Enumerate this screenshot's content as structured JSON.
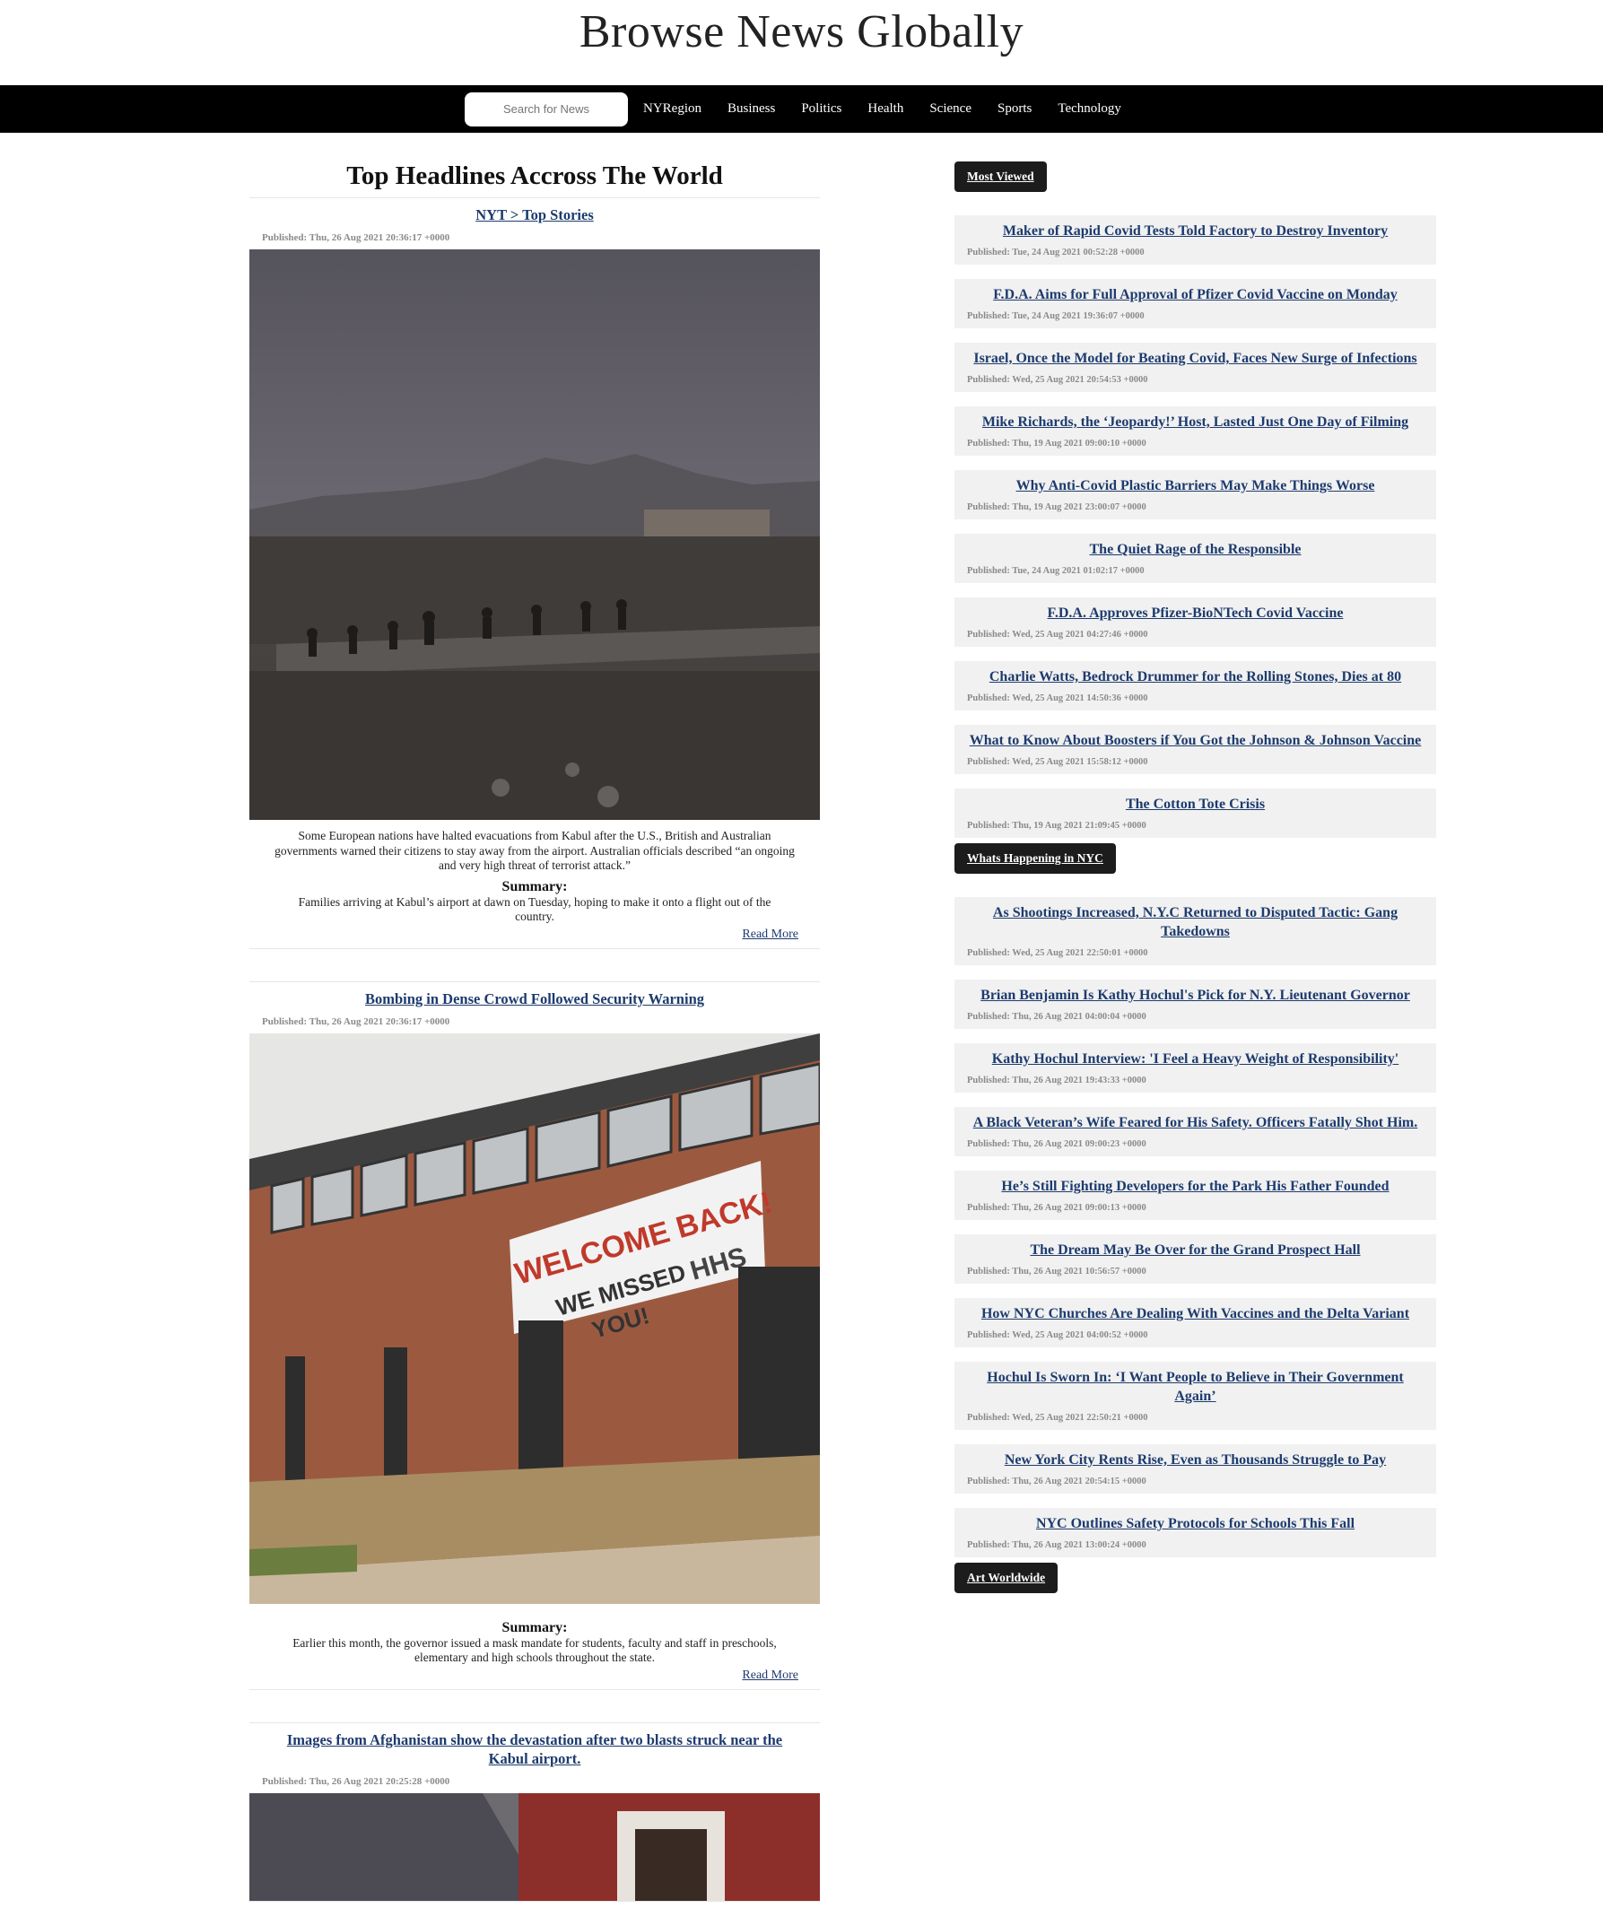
{
  "site": {
    "title": "Browse News Globally"
  },
  "nav": {
    "search_placeholder": "Search for News",
    "links": [
      "NYRegion",
      "Business",
      "Politics",
      "Health",
      "Science",
      "Sports",
      "Technology"
    ]
  },
  "main": {
    "heading": "Top Headlines Accross The World",
    "stories": [
      {
        "title": "NYT > Top Stories",
        "published": "Published: Thu, 26 Aug 2021 20:36:17 +0000",
        "caption": "Some European nations have halted evacuations from Kabul after the U.S., British and Australian governments warned their citizens to stay away from the airport. Australian officials described “an ongoing and very high threat of terrorist attack.”",
        "summary_label": "Summary:",
        "summary": "Families arriving at Kabul’s airport at dawn on Tuesday, hoping to make it onto a flight out of the country.",
        "read_more": "Read More"
      },
      {
        "title": "Bombing in Dense Crowd Followed Security Warning",
        "published": "Published: Thu, 26 Aug 2021 20:36:17 +0000",
        "photo_text": [
          "WELCOME BACK!",
          "WE MISSED",
          "YOU!",
          "HHS"
        ],
        "summary_label": "Summary:",
        "summary": "Earlier this month, the governor issued a mask mandate for students, faculty and staff in preschools, elementary and high schools throughout the state.",
        "read_more": "Read More"
      },
      {
        "title": "Images from Afghanistan show the devastation after two blasts struck near the Kabul airport.",
        "published": "Published: Thu, 26 Aug 2021 20:25:28 +0000"
      }
    ]
  },
  "sidebar": {
    "most_viewed_label": "Most Viewed",
    "most_viewed": [
      {
        "title": "Maker of Rapid Covid Tests Told Factory to Destroy Inventory",
        "published": "Published: Tue, 24 Aug 2021 00:52:28 +0000"
      },
      {
        "title": "F.D.A. Aims for Full Approval of Pfizer Covid Vaccine on Monday",
        "published": "Published: Tue, 24 Aug 2021 19:36:07 +0000"
      },
      {
        "title": "Israel, Once the Model for Beating Covid, Faces New Surge of Infections",
        "published": "Published: Wed, 25 Aug 2021 20:54:53 +0000"
      },
      {
        "title": "Mike Richards, the ‘Jeopardy!’ Host, Lasted Just One Day of Filming",
        "published": "Published: Thu, 19 Aug 2021 09:00:10 +0000"
      },
      {
        "title": "Why Anti-Covid Plastic Barriers May Make Things Worse",
        "published": "Published: Thu, 19 Aug 2021 23:00:07 +0000"
      },
      {
        "title": "The Quiet Rage of the Responsible",
        "published": "Published: Tue, 24 Aug 2021 01:02:17 +0000"
      },
      {
        "title": "F.D.A. Approves Pfizer-BioNTech Covid Vaccine",
        "published": "Published: Wed, 25 Aug 2021 04:27:46 +0000"
      },
      {
        "title": "Charlie Watts, Bedrock Drummer for the Rolling Stones, Dies at 80",
        "published": "Published: Wed, 25 Aug 2021 14:50:36 +0000"
      },
      {
        "title": "What to Know About Boosters if You Got the Johnson & Johnson Vaccine",
        "published": "Published: Wed, 25 Aug 2021 15:58:12 +0000"
      },
      {
        "title": "The Cotton Tote Crisis",
        "published": "Published: Thu, 19 Aug 2021 21:09:45 +0000"
      }
    ],
    "nyc_label": "Whats Happening in NYC",
    "nyc": [
      {
        "title": "As Shootings Increased, N.Y.C Returned to Disputed Tactic: Gang Takedowns",
        "published": "Published: Wed, 25 Aug 2021 22:50:01 +0000"
      },
      {
        "title": "Brian Benjamin Is Kathy Hochul's Pick for N.Y. Lieutenant Governor",
        "published": "Published: Thu, 26 Aug 2021 04:00:04 +0000"
      },
      {
        "title": "Kathy Hochul Interview: 'I Feel a Heavy Weight of Responsibility'",
        "published": "Published: Thu, 26 Aug 2021 19:43:33 +0000"
      },
      {
        "title": "A Black Veteran’s Wife Feared for His Safety. Officers Fatally Shot Him.",
        "published": "Published: Thu, 26 Aug 2021 09:00:23 +0000"
      },
      {
        "title": "He’s Still Fighting Developers for the Park His Father Founded",
        "published": "Published: Thu, 26 Aug 2021 09:00:13 +0000"
      },
      {
        "title": "The Dream May Be Over for the Grand Prospect Hall",
        "published": "Published: Thu, 26 Aug 2021 10:56:57 +0000"
      },
      {
        "title": "How NYC Churches Are Dealing With Vaccines and the Delta Variant",
        "published": "Published: Wed, 25 Aug 2021 04:00:52 +0000"
      },
      {
        "title": "Hochul Is Sworn In: ‘I Want People to Believe in Their Government Again’",
        "published": "Published: Wed, 25 Aug 2021 22:50:21 +0000"
      },
      {
        "title": "New York City Rents Rise, Even as Thousands Struggle to Pay",
        "published": "Published: Thu, 26 Aug 2021 20:54:15 +0000"
      },
      {
        "title": "NYC Outlines Safety Protocols for Schools This Fall",
        "published": "Published: Thu, 26 Aug 2021 13:00:24 +0000"
      }
    ],
    "art_label": "Art Worldwide"
  }
}
